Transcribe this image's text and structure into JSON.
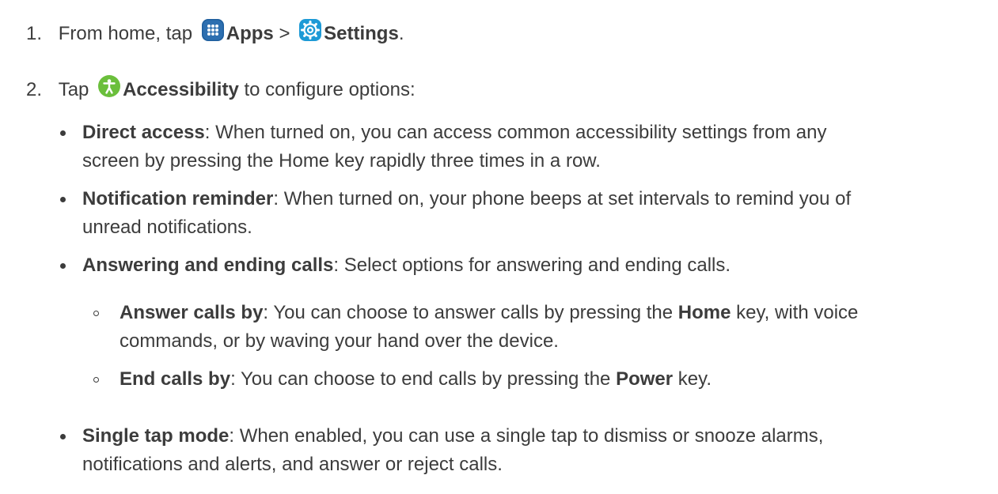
{
  "steps": [
    {
      "number": "1.",
      "prefix": "From home, tap",
      "apps_icon": "apps-grid-icon",
      "apps_label": "Apps",
      "separator": ">",
      "settings_icon": "settings-gear-icon",
      "settings_label": "Settings",
      "suffix": "."
    },
    {
      "number": "2.",
      "prefix": "Tap",
      "accessibility_icon": "accessibility-person-icon",
      "accessibility_label": "Accessibility",
      "suffix": "to configure options:"
    }
  ],
  "options": [
    {
      "term": "Direct access",
      "line1": ": When turned on, you can access common accessibility settings from any",
      "line2": "screen by pressing the Home key rapidly three times in a row."
    },
    {
      "term": "Notification reminder",
      "line1": ": When turned on, your phone beeps at set intervals to remind you of",
      "line2": "unread notifications."
    },
    {
      "term": "Answering and ending calls",
      "line1": ": Select options for answering and ending calls."
    },
    {
      "term": "Single tap mode",
      "line1": ": When enabled, you can use a single tap to dismiss or snooze alarms,",
      "line2": "notifications and alerts, and answer or reject calls."
    }
  ],
  "sub_options": [
    {
      "term": "Answer calls by",
      "line1_a": ": You can choose to answer calls by pressing the",
      "key": "Home",
      "line1_b": "key, with voice",
      "line2": "commands, or by waving your hand over the device."
    },
    {
      "term": "End calls by",
      "line1_a": ": You can choose to end calls by pressing the",
      "key": "Power",
      "line1_b": "key."
    }
  ],
  "colors": {
    "text": "#3c3c3c",
    "apps_icon": "#2d6fb0",
    "settings_icon": "#1e9ad6",
    "accessibility_icon": "#6bbf3c"
  }
}
